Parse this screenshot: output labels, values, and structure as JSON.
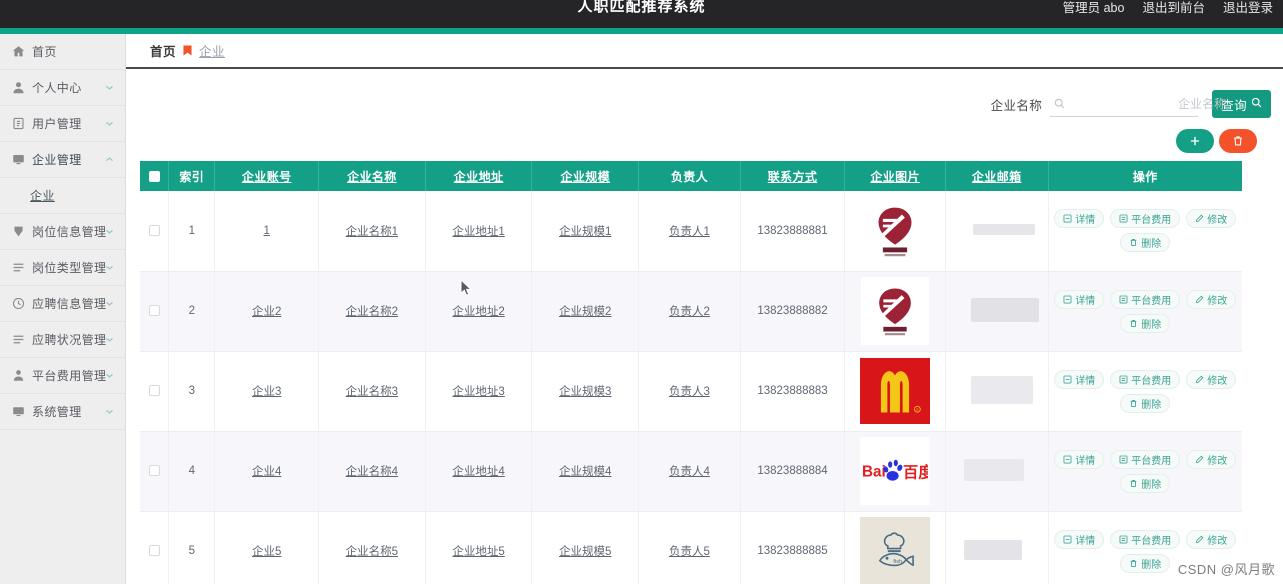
{
  "app": {
    "title": "人职匹配推荐系统",
    "accent_teal": "#14a086",
    "accent_orange": "#f4522a",
    "topbar_bg": "#252528"
  },
  "topbar": {
    "user_label": "管理员 abo",
    "exit_front_label": "退出到前台",
    "logout_label": "退出登录"
  },
  "sidebar": {
    "items": [
      {
        "label": "首页",
        "icon": "home-icon",
        "expandable": false,
        "expanded": false
      },
      {
        "label": "个人中心",
        "icon": "user-icon",
        "expandable": true,
        "expanded": false
      },
      {
        "label": "用户管理",
        "icon": "id-card-icon",
        "expandable": true,
        "expanded": false
      },
      {
        "label": "企业管理",
        "icon": "monitor-icon",
        "expandable": true,
        "expanded": true
      },
      {
        "label": "岗位信息管理",
        "icon": "pin-icon",
        "expandable": true,
        "expanded": false
      },
      {
        "label": "岗位类型管理",
        "icon": "list-icon",
        "expandable": true,
        "expanded": false
      },
      {
        "label": "应聘信息管理",
        "icon": "clock-icon",
        "expandable": true,
        "expanded": false
      },
      {
        "label": "应聘状况管理",
        "icon": "list-icon",
        "expandable": true,
        "expanded": false
      },
      {
        "label": "平台费用管理",
        "icon": "person-icon",
        "expandable": true,
        "expanded": false
      },
      {
        "label": "系统管理",
        "icon": "monitor-icon",
        "expandable": true,
        "expanded": false
      }
    ],
    "submenu": {
      "parent": "企业管理",
      "label": "企业"
    }
  },
  "breadcrumb": {
    "home": "首页",
    "separator_icon": "bookmark-icon",
    "current": "企业"
  },
  "search": {
    "label": "企业名称",
    "value": "",
    "placeholder": "企业名称",
    "icon": "search-icon",
    "button_label": "查询",
    "button_icon": "search-icon"
  },
  "toolbar": {
    "add_icon": "plus-icon",
    "add_label": "",
    "delete_icon": "trash-icon",
    "delete_label": ""
  },
  "table": {
    "select_all_checked": true,
    "columns": [
      {
        "key": "check",
        "label": "",
        "underline": false
      },
      {
        "key": "index",
        "label": "索引",
        "underline": false
      },
      {
        "key": "account",
        "label": "企业账号",
        "underline": true
      },
      {
        "key": "name",
        "label": "企业名称",
        "underline": true
      },
      {
        "key": "address",
        "label": "企业地址",
        "underline": true
      },
      {
        "key": "scale",
        "label": "企业规模",
        "underline": true
      },
      {
        "key": "owner",
        "label": "负责人",
        "underline": false
      },
      {
        "key": "phone",
        "label": "联系方式",
        "underline": true
      },
      {
        "key": "image",
        "label": "企业图片",
        "underline": true
      },
      {
        "key": "email",
        "label": "企业邮箱",
        "underline": true
      },
      {
        "key": "ops",
        "label": "操作",
        "underline": false
      }
    ],
    "rows": [
      {
        "index": "1",
        "account": "1",
        "name": "企业名称1",
        "address": "企业地址1",
        "scale": "企业规模1",
        "owner": "负责人1",
        "phone": "13823888881",
        "image": "bohui-logo",
        "email": "",
        "checked": false
      },
      {
        "index": "2",
        "account": "企业2",
        "name": "企业名称2",
        "address": "企业地址2",
        "scale": "企业规模2",
        "owner": "负责人2",
        "phone": "13823888882",
        "image": "bohui-logo",
        "email": "",
        "checked": false
      },
      {
        "index": "3",
        "account": "企业3",
        "name": "企业名称3",
        "address": "企业地址3",
        "scale": "企业规模3",
        "owner": "负责人3",
        "phone": "13823888883",
        "image": "mcdonalds-logo",
        "email": "",
        "checked": false
      },
      {
        "index": "4",
        "account": "企业4",
        "name": "企业名称4",
        "address": "企业地址4",
        "scale": "企业规模4",
        "owner": "负责人4",
        "phone": "13823888884",
        "image": "baidu-logo",
        "email": "",
        "checked": false
      },
      {
        "index": "5",
        "account": "企业5",
        "name": "企业名称5",
        "address": "企业地址5",
        "scale": "企业规模5",
        "owner": "负责人5",
        "phone": "13823888885",
        "image": "fish-chef-logo",
        "email": "",
        "checked": false
      }
    ],
    "ops": [
      {
        "label": "详情",
        "icon": "detail-icon"
      },
      {
        "label": "平台费用",
        "icon": "fee-icon"
      },
      {
        "label": "修改",
        "icon": "edit-icon"
      },
      {
        "label": "删除",
        "icon": "trash-icon"
      }
    ]
  },
  "watermark": "CSDN @风月歌"
}
